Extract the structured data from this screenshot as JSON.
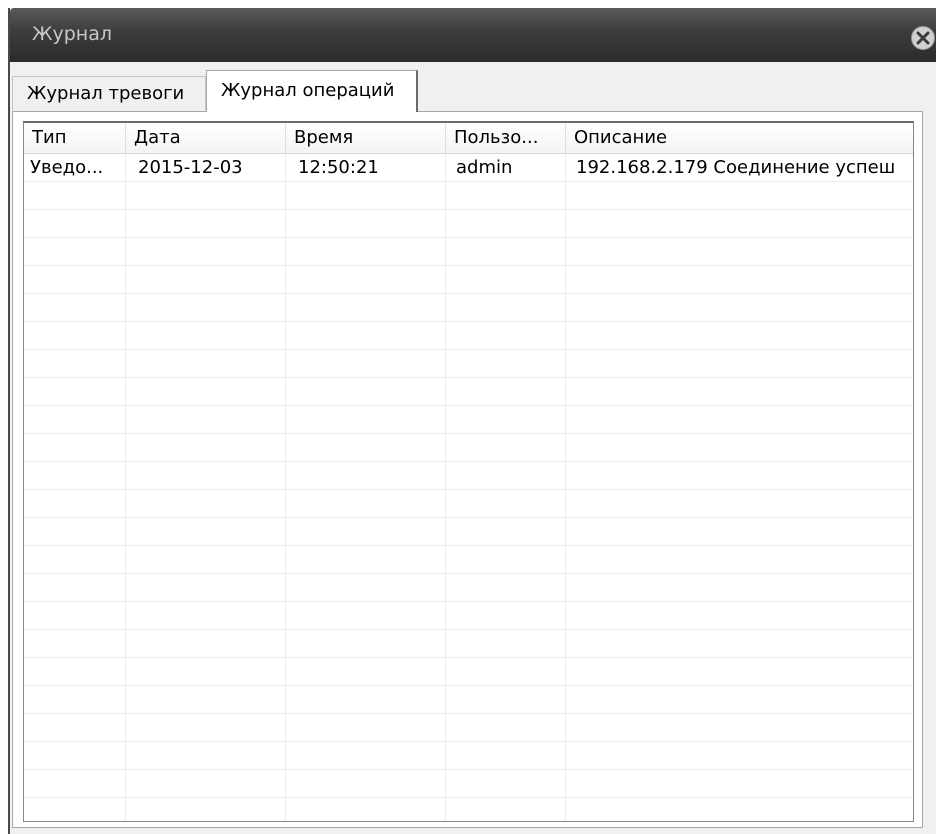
{
  "window": {
    "title": "Журнал"
  },
  "tabs": [
    {
      "label": "Журнал тревоги",
      "active": false
    },
    {
      "label": "Журнал операций",
      "active": true
    }
  ],
  "table": {
    "columns": [
      "Тип",
      "Дата",
      "Время",
      "Пользо...",
      "Описание"
    ],
    "rows": [
      {
        "type": "Уведо...",
        "date": "2015-12-03",
        "time": "12:50:21",
        "user": "admin",
        "description": "192.168.2.179  Соединение успеш"
      }
    ]
  },
  "icons": {
    "close": "close-icon"
  },
  "colors": {
    "titlebar_top": "#5a5a5a",
    "titlebar_bottom": "#2b2b2b",
    "title_text": "#c8c8c8",
    "window_bg": "#f0f0f0"
  }
}
